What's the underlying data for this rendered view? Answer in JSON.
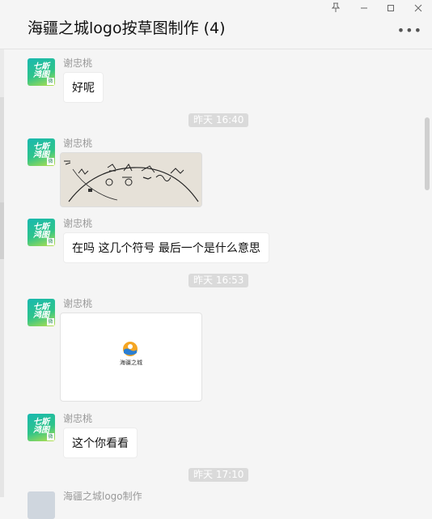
{
  "window": {
    "title": "海疆之城logo按草图制作 (4)",
    "pin_icon": "pin-icon",
    "minimize_icon": "minimize-icon",
    "maximize_icon": "maximize-icon",
    "close_icon": "close-icon",
    "more_icon": "more-icon"
  },
  "messages": [
    {
      "sender": "谢忠桃",
      "text": "好呢"
    },
    {
      "time": "昨天 16:40"
    },
    {
      "sender": "谢忠桃",
      "type": "image"
    },
    {
      "sender": "谢忠桃",
      "text": "在吗 这几个符号  最后一个是什么意思"
    },
    {
      "time": "昨天 16:53"
    },
    {
      "sender": "谢忠桃",
      "type": "file-image",
      "logo_text": "海疆之城"
    },
    {
      "sender": "谢忠桃",
      "text": "这个你看看"
    },
    {
      "time": "昨天 17:10"
    },
    {
      "sender": "海疆之城logo制作"
    }
  ],
  "avatar": {
    "text": "七斯\n鸿图",
    "tag": "微"
  },
  "colors": {
    "accent": "#2fc48a",
    "background": "#f5f5f5",
    "pill": "#dadada"
  }
}
